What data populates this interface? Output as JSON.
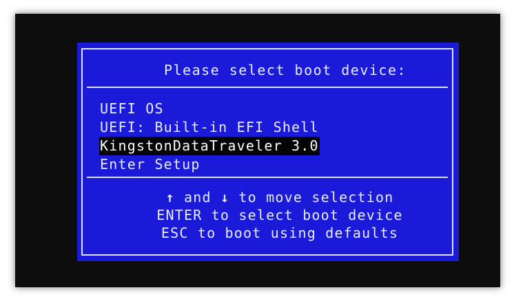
{
  "boot_menu": {
    "title": "Please select boot device:",
    "items": [
      {
        "label": "UEFI OS",
        "selected": false
      },
      {
        "label": "UEFI: Built-in EFI Shell",
        "selected": false
      },
      {
        "label": "KingstonDataTraveler 3.0",
        "selected": true
      },
      {
        "label": "Enter Setup",
        "selected": false
      }
    ],
    "help": {
      "line1_arrow_up": "↑",
      "line1_and": " and ",
      "line1_arrow_down": "↓",
      "line1_rest": " to move selection",
      "line2": "ENTER to select boot device",
      "line3": "ESC to boot using defaults"
    }
  },
  "colors": {
    "menu_background": "#1a1ad8",
    "text": "#e8ecff",
    "selection_background": "#050505",
    "screen_bezel": "#0d0d0d"
  }
}
